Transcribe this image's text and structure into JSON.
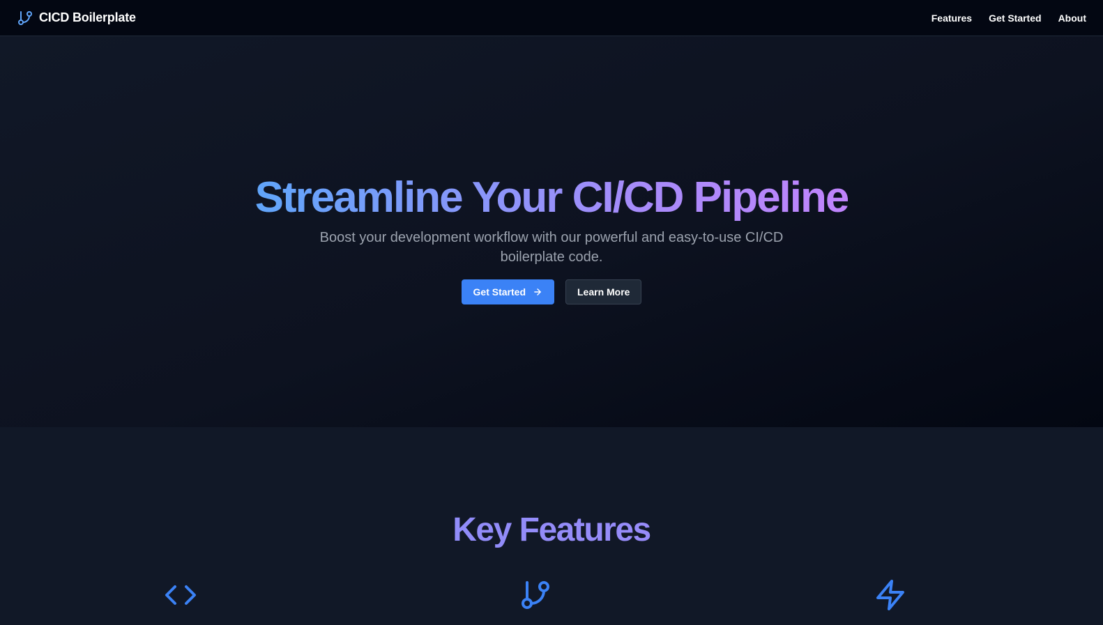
{
  "header": {
    "brand_icon": "git-branch-icon",
    "brand_name": "CICD Boilerplate",
    "nav": {
      "features": "Features",
      "get_started": "Get Started",
      "about": "About"
    }
  },
  "hero": {
    "title": "Streamline Your CI/CD Pipeline",
    "subtitle": "Boost your development workflow with our powerful and easy-to-use CI/CD boilerplate code.",
    "primary_button": "Get Started",
    "primary_button_icon": "arrow-right-icon",
    "secondary_button": "Learn More"
  },
  "features": {
    "title": "Key Features",
    "icons": [
      "code-icon",
      "git-branch-icon",
      "lightning-icon"
    ]
  },
  "colors": {
    "accent": "#3b82f6",
    "background": "#111827",
    "header_background": "#030712",
    "gradient_start": "#60a5fa",
    "gradient_end": "#c084fc"
  }
}
